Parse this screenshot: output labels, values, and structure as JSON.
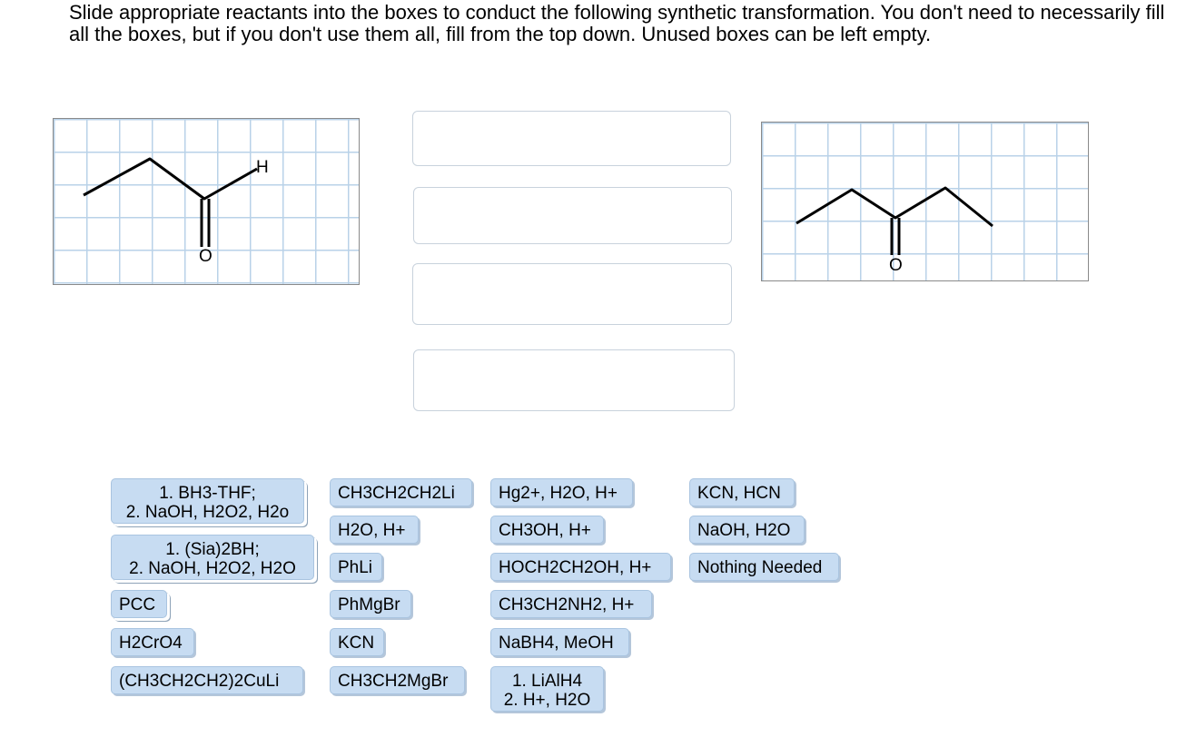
{
  "instructions": "Slide appropriate reactants into the boxes to conduct the following synthetic transformation.  You don't need to necessarily fill all the boxes, but if you don't use them all, fill from the top down.  Unused boxes can be left empty.",
  "starting_material": {
    "atom_labels": {
      "hydrogen": "H",
      "oxygen": "O"
    }
  },
  "product": {
    "atom_labels": {
      "oxygen": "O"
    }
  },
  "reagents": {
    "r1": {
      "line1": "1.  BH3-THF;",
      "line2": "2. NaOH, H2O2, H2o"
    },
    "r2": {
      "line1": "1. (Sia)2BH;",
      "line2": "2.  NaOH, H2O2, H2O"
    },
    "r3": "PCC",
    "r4": "H2CrO4",
    "r5": "(CH3CH2CH2)2CuLi",
    "r6": "CH3CH2CH2Li",
    "r7": "H2O, H+",
    "r8": "PhLi",
    "r9": "PhMgBr",
    "r10": "KCN",
    "r11": "CH3CH2MgBr",
    "r12": "Hg2+, H2O, H+",
    "r13": "CH3OH, H+",
    "r14": "HOCH2CH2OH, H+",
    "r15": "CH3CH2NH2, H+",
    "r16": "NaBH4, MeOH",
    "r17": {
      "line1": "1.  LiAlH4",
      "line2": "2.  H+, H2O"
    },
    "r18": "KCN, HCN",
    "r19": "NaOH, H2O",
    "r20": "Nothing Needed"
  },
  "colors": {
    "chip": "#c7dcf2",
    "grid_line": "#b9d2e8"
  }
}
